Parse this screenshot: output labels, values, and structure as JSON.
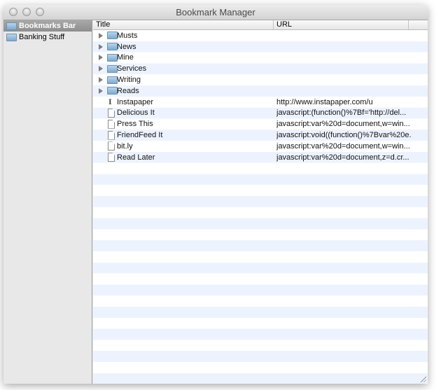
{
  "window": {
    "title": "Bookmark Manager"
  },
  "sidebar": {
    "items": [
      {
        "label": "Bookmarks Bar",
        "selected": true
      },
      {
        "label": "Banking Stuff",
        "selected": false
      }
    ]
  },
  "table": {
    "columns": [
      "Title",
      "URL"
    ],
    "rows": [
      {
        "title": "Musts",
        "url": "",
        "type": "folder"
      },
      {
        "title": "News",
        "url": "",
        "type": "folder"
      },
      {
        "title": "Mine",
        "url": "",
        "type": "folder"
      },
      {
        "title": "Services",
        "url": "",
        "type": "folder"
      },
      {
        "title": "Writing",
        "url": "",
        "type": "folder"
      },
      {
        "title": "Reads",
        "url": "",
        "type": "folder"
      },
      {
        "title": "Instapaper",
        "url": "http://www.instapaper.com/u",
        "type": "instapaper"
      },
      {
        "title": "Delicious It",
        "url": "javascript:(function()%7Bf='http://del...",
        "type": "page"
      },
      {
        "title": "Press This",
        "url": "javascript:var%20d=document,w=win...",
        "type": "page"
      },
      {
        "title": "FriendFeed It",
        "url": "javascript:void((function()%7Bvar%20e...",
        "type": "page"
      },
      {
        "title": "bit.ly",
        "url": "javascript:var%20d=document,w=win...",
        "type": "page"
      },
      {
        "title": "Read Later",
        "url": "javascript:var%20d=document,z=d.cr...",
        "type": "page"
      }
    ]
  }
}
